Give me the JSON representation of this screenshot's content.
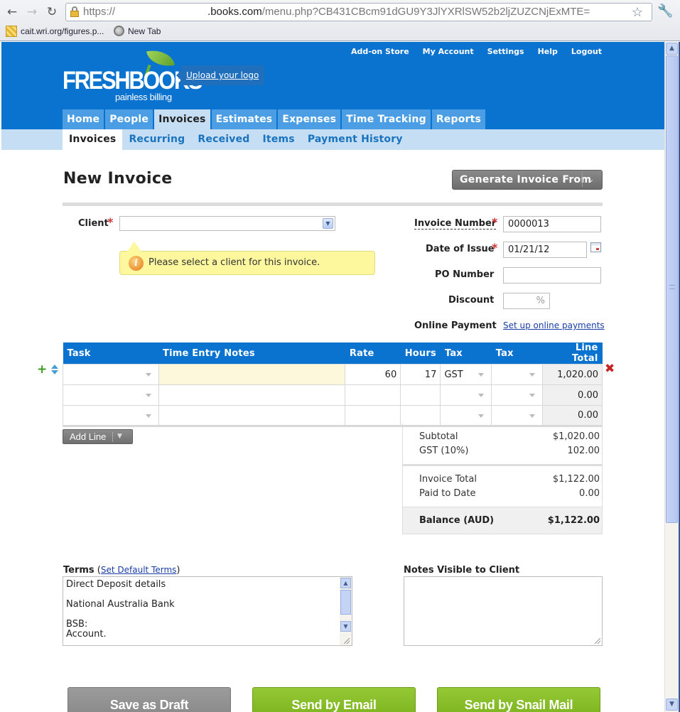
{
  "browser": {
    "url_scheme": "https://",
    "url_domain": ".books.com",
    "url_path": "/menu.php?CB431CBcm91dGU9Y3JlYXRlSW52b2ljZUZCNjExMTE=",
    "bookmarks": [
      {
        "label": "cait.wri.org/figures.p...",
        "icon": "grid-favicon"
      },
      {
        "label": "New Tab",
        "icon": "globe-icon"
      }
    ]
  },
  "header": {
    "logo_word": "FRESHBOOKS",
    "logo_tagline": "painless billing",
    "upload_logo": "Upload your logo",
    "top_links": [
      "Add-on Store",
      "My Account",
      "Settings",
      "Help",
      "Logout"
    ],
    "main_tabs": [
      {
        "label": "Home",
        "active": false
      },
      {
        "label": "People",
        "active": false
      },
      {
        "label": "Invoices",
        "active": true
      },
      {
        "label": "Estimates",
        "active": false
      },
      {
        "label": "Expenses",
        "active": false
      },
      {
        "label": "Time Tracking",
        "active": false
      },
      {
        "label": "Reports",
        "active": false
      }
    ],
    "sub_tabs": [
      {
        "label": "Invoices",
        "active": true
      },
      {
        "label": "Recurring",
        "active": false
      },
      {
        "label": "Received",
        "active": false
      },
      {
        "label": "Items",
        "active": false
      },
      {
        "label": "Payment History",
        "active": false
      }
    ]
  },
  "page": {
    "title": "New Invoice",
    "generate_button": "Generate Invoice From"
  },
  "form": {
    "client_label": "Client",
    "client_value": "",
    "client_tip": "Please select a client for this invoice.",
    "invoice_number_label": "Invoice Number",
    "invoice_number": "0000013",
    "date_label": "Date of Issue",
    "date_value": "01/21/12",
    "po_label": "PO Number",
    "po_value": "",
    "discount_label": "Discount",
    "discount_suffix": "%",
    "online_payment_label": "Online Payment",
    "online_payment_link": "Set up online payments",
    "required_mark": "*"
  },
  "lines": {
    "headers": [
      "Task",
      "Time Entry Notes",
      "Rate",
      "Hours",
      "Tax",
      "Tax",
      "Line Total"
    ],
    "rows": [
      {
        "task": "",
        "notes": "",
        "rate": "60",
        "hours": "17",
        "tax1": "GST",
        "tax2": "",
        "total": "1,020.00"
      },
      {
        "task": "",
        "notes": "",
        "rate": "",
        "hours": "",
        "tax1": "",
        "tax2": "",
        "total": "0.00"
      },
      {
        "task": "",
        "notes": "",
        "rate": "",
        "hours": "",
        "tax1": "",
        "tax2": "",
        "total": "0.00"
      }
    ],
    "add_line": "Add Line"
  },
  "totals": {
    "subtotal_label": "Subtotal",
    "subtotal": "$1,020.00",
    "tax_label": "GST (10%)",
    "tax": "102.00",
    "invoice_total_label": "Invoice Total",
    "invoice_total": "$1,122.00",
    "paid_label": "Paid to Date",
    "paid": "0.00",
    "balance_label": "Balance (AUD)",
    "balance": "$1,122.00"
  },
  "terms": {
    "label": "Terms",
    "link": "Set Default Terms",
    "value": "Direct Deposit details\n\nNational Australia Bank\n\nBSB:\nAccount."
  },
  "notes": {
    "label": "Notes Visible to Client",
    "value": ""
  },
  "actions": {
    "save_draft": "Save as Draft",
    "send_email": "Send by Email",
    "send_snail": "Send by Snail Mail"
  }
}
